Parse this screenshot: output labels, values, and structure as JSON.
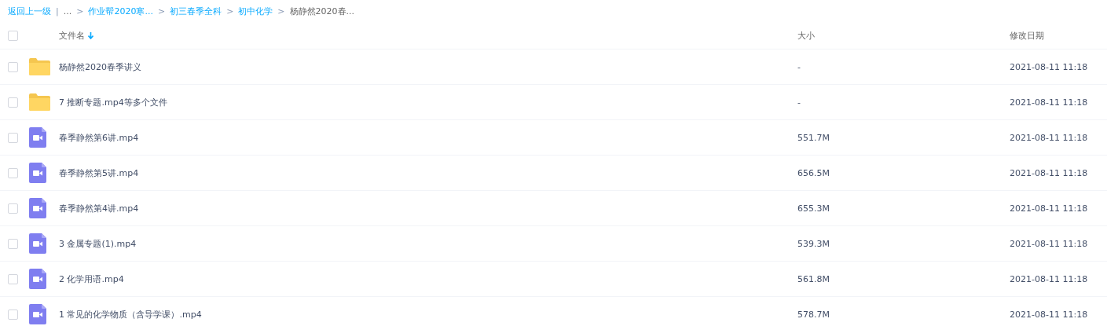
{
  "breadcrumb": [
    {
      "kind": "link",
      "text": "返回上一级"
    },
    {
      "kind": "divider",
      "text": "|"
    },
    {
      "kind": "text",
      "text": "..."
    },
    {
      "kind": "separator",
      "text": ">"
    },
    {
      "kind": "link",
      "text": "作业帮2020寒..."
    },
    {
      "kind": "separator",
      "text": ">"
    },
    {
      "kind": "link",
      "text": "初三春季全科"
    },
    {
      "kind": "separator",
      "text": ">"
    },
    {
      "kind": "link",
      "text": "初中化学"
    },
    {
      "kind": "separator",
      "text": ">"
    },
    {
      "kind": "text",
      "text": "杨静然2020春..."
    }
  ],
  "table": {
    "select_all": {
      "checked": false
    },
    "columns": [
      {
        "label": "文件名",
        "sorted": true
      },
      {
        "label": "大小",
        "sorted": false
      },
      {
        "label": "修改日期",
        "sorted": false
      }
    ],
    "rows": [
      {
        "kind": "folder",
        "checked": false,
        "name": "杨静然2020春季讲义",
        "size": "-",
        "date": "2021-08-11 11:18"
      },
      {
        "kind": "folder",
        "checked": false,
        "name": "7 推断专题.mp4等多个文件",
        "size": "-",
        "date": "2021-08-11 11:18"
      },
      {
        "kind": "video",
        "checked": false,
        "name": "春季静然第6讲.mp4",
        "size": "551.7M",
        "date": "2021-08-11 11:18"
      },
      {
        "kind": "video",
        "checked": false,
        "name": "春季静然第5讲.mp4",
        "size": "656.5M",
        "date": "2021-08-11 11:18"
      },
      {
        "kind": "video",
        "checked": false,
        "name": "春季静然第4讲.mp4",
        "size": "655.3M",
        "date": "2021-08-11 11:18"
      },
      {
        "kind": "video",
        "checked": false,
        "name": "3 金属专题(1).mp4",
        "size": "539.3M",
        "date": "2021-08-11 11:18"
      },
      {
        "kind": "video",
        "checked": false,
        "name": "2 化学用语.mp4",
        "size": "561.8M",
        "date": "2021-08-11 11:18"
      },
      {
        "kind": "video",
        "checked": false,
        "name": "1 常见的化学物质（含导学课）.mp4",
        "size": "578.7M",
        "date": "2021-08-11 11:18"
      }
    ]
  }
}
